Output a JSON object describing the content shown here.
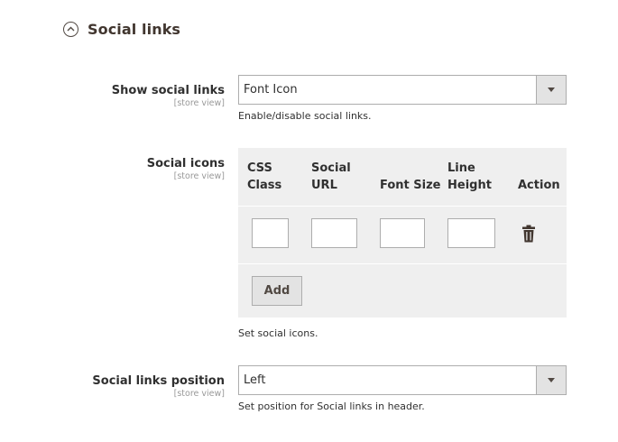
{
  "section": {
    "title": "Social links",
    "collapse_icon": "chevron-up-icon"
  },
  "fields": {
    "show_social_links": {
      "label": "Show social links",
      "scope": "[store view]",
      "value": "Font Icon",
      "note": "Enable/disable social links."
    },
    "social_icons": {
      "label": "Social icons",
      "scope": "[store view]",
      "columns": {
        "css_class": "CSS Class",
        "social_url": "Social URL",
        "font_size": "Font Size",
        "line_height": "Line Height",
        "action": "Action"
      },
      "rows": [
        {
          "css_class": "",
          "social_url": "",
          "font_size": "",
          "line_height": "",
          "action_icon": "trash-icon"
        }
      ],
      "add_label": "Add",
      "note": "Set social icons."
    },
    "social_links_position": {
      "label": "Social links position",
      "scope": "[store view]",
      "value": "Left",
      "note": "Set position for Social links in header."
    }
  },
  "colors": {
    "panel_bg": "#efefef",
    "border": "#adadad",
    "button_bg": "#e3e3e3",
    "text": "#303030",
    "scope_text": "#999999"
  }
}
